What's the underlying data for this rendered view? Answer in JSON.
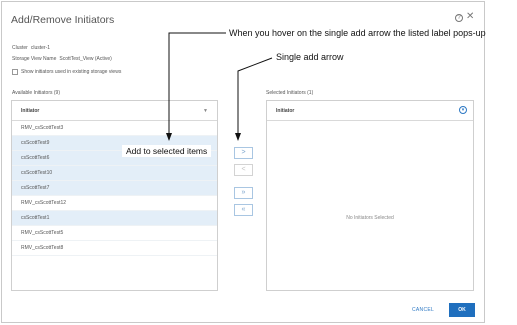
{
  "dialog": {
    "title": "Add/Remove Initiators",
    "cluster_label": "Cluster",
    "cluster_value": "cluster-1",
    "storage_view_label": "Storage View Name",
    "storage_view_value": "ScottTest_View (Active)",
    "show_used_checkbox_label": "Show initiators used in existing storage views",
    "show_used_checked": false
  },
  "available": {
    "label": "Available Initiators (9)",
    "header": "Initiator",
    "rows": [
      {
        "name": "RMV_csScottTest3",
        "selected": false
      },
      {
        "name": "csScottTest9",
        "selected": true
      },
      {
        "name": "csScottTest6",
        "selected": true
      },
      {
        "name": "csScottTest10",
        "selected": true
      },
      {
        "name": "csScottTest7",
        "selected": true
      },
      {
        "name": "RMV_csScottTest12",
        "selected": false
      },
      {
        "name": "csScottTest1",
        "selected": true
      },
      {
        "name": "RMV_csScottTest5",
        "selected": false
      },
      {
        "name": "RMV_csScottTest8",
        "selected": false
      }
    ]
  },
  "selected": {
    "label": "Selected Initiators (1)",
    "header": "Initiator",
    "empty_text": "No Initiators Selected"
  },
  "arrows": {
    "add_single": ">",
    "remove_single": "<",
    "add_all": "»",
    "remove_all": "«"
  },
  "tooltip": "Add to selected items",
  "footer": {
    "cancel": "CANCEL",
    "ok": "OK"
  },
  "annotations": {
    "hover_note": "When you hover on the single add arrow the listed label pops-up",
    "arrow_note": "Single add arrow"
  },
  "colors": {
    "accent": "#1f6fbe",
    "selected_row": "#e3eef8"
  }
}
